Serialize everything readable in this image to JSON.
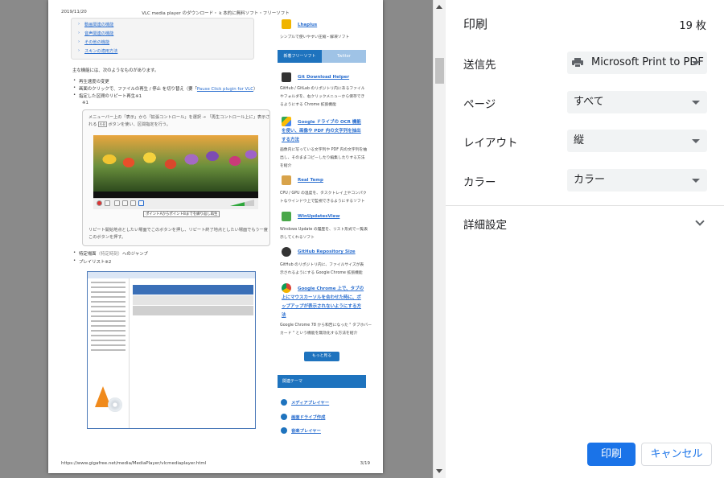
{
  "preview": {
    "header_date": "2019/11/20",
    "header_title": "VLC media player のダウンロード・ k 本的に無料ソフト・フリーソフト",
    "footer_url": "https://www.gigafree.net/media/MediaPlayer/vlcmediaplayer.html",
    "footer_page": "3/19",
    "toc_items": [
      "動画関連の機能",
      "音声関連の機能",
      "その他の機能",
      "スキンの適用方法"
    ],
    "intro": "主な機能には、次のようなものがあります。",
    "bullets": [
      "再生速度の変更",
      "画面のクリックで、ファイルの再生 / 停止 を切り替え（要「",
      "指定した区間のリピート再生※1"
    ],
    "bullet2_link": "Pause Click plugin for VLC",
    "bullet2_tail": "）",
    "note_mark": "※1",
    "note_line1": "メニューバー上の「表示」から「拡張コントロール」を選択 → 「再生コントロール上に」表示さ",
    "note_line1b": "れる",
    "note_line2": "ボタンを使い、区間指定を行う。",
    "tooltip": "ポイントAからポイントBまでを繰り返し再生",
    "note_bottom1": "リピート開始地点としたい場面でこのボタンを押し、リピート終了地点としたい場面でもう一度",
    "note_bottom2": "このボタンを押す。",
    "bullet_jump": "特定場面",
    "bullet_jump_note": "（特定時刻）",
    "bullet_jump_tail": "へのジャンプ",
    "bullet_playlist": "プレイリスト※2",
    "right_col": {
      "item0_title": "Lhaplus",
      "item0_desc": "シンプルで使いやすい圧縮・解凍ソフト",
      "tab_new": "新着フリーソフト",
      "tab_twitter": "Twitter",
      "items": [
        {
          "title": "Git Download Helper",
          "desc1": "GitHub / GitLab のリポジトリ内にあるファイル",
          "desc2": "やフォルダを、右クリックメニューから保存でき",
          "desc3": "るようにする Chrome 拡張機能"
        },
        {
          "title": "Google ドライブの OCR 機能",
          "title2": "を使い、画像や PDF 内の文字列を抽出",
          "title3": "する方法",
          "desc1": "画像内に写っている文字列や PDF 内の文字列を抽",
          "desc2": "出し、そのままコピーしたり編集したりする方法",
          "desc3": "を紹介"
        },
        {
          "title": "Real Temp",
          "desc1": "CPU / GPU の温度を、タスクトレイ上やコンパク",
          "desc2": "トなウインドウ上で監視できるようにするソフト"
        },
        {
          "title": "WinUpdatesView",
          "desc1": "Windows Update の履歴を、リスト形式で一覧表",
          "desc2": "示してくれるソフト"
        },
        {
          "title": "GitHub Repository Size",
          "desc1": "GitHub のリポジトリ内に、ファイルサイズが表",
          "desc2": "示されるようにする Google Chrome 拡張機能"
        },
        {
          "title": "Google Chrome 上で、タブの",
          "title2": "上にマウスカーソルを合わせた時に、ポ",
          "title3": "ップアップが表示されないようにする方",
          "title4": "法",
          "desc1": "Google Chrome 78 から和告になった \" タブホバー",
          "desc2": "カード \" という機能を無効化する方法を紹介"
        }
      ],
      "more": "もっと見る",
      "theme_header": "関連テーマ",
      "themes": [
        "メディアプレイヤー",
        "画面ドライブ作成",
        "音楽プレイヤー"
      ]
    }
  },
  "panel": {
    "title": "印刷",
    "sheet_count": "19 枚",
    "destination_label": "送信先",
    "destination_value": "Microsoft Print to PDF",
    "pages_label": "ページ",
    "pages_value": "すべて",
    "layout_label": "レイアウト",
    "layout_value": "縦",
    "color_label": "カラー",
    "color_value": "カラー",
    "advanced_label": "詳細設定",
    "print_button": "印刷",
    "cancel_button": "キャンセル"
  },
  "colors": {
    "accent": "#1a73e8",
    "preview_bg": "#8a8a8a",
    "select_bg": "#f1f3f4"
  }
}
